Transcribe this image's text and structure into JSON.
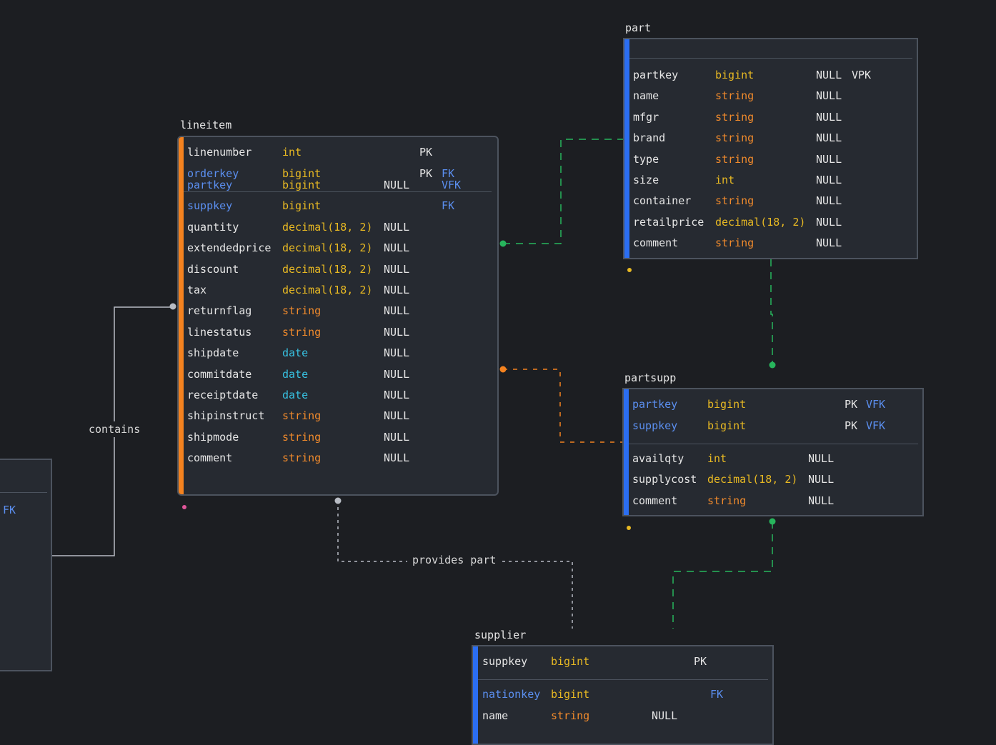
{
  "colors": {
    "background": "#1c1e22",
    "table_bg": "#262a31",
    "border": "#4c535e",
    "accent_orange": "#f4821f",
    "accent_blue": "#2b6ef2",
    "type_yellow": "#e8b923",
    "type_orange": "#f08a2c",
    "type_cyan": "#37c0e0",
    "fk_blue": "#5b8ff0",
    "edge_green": "#27b55c",
    "edge_orange": "#f4821f",
    "edge_gray": "#b8bcc4"
  },
  "edges": {
    "contains": "contains",
    "provides_part": "provides part"
  },
  "lineitem": {
    "title": "lineitem",
    "keys": [
      {
        "name": "linenumber",
        "type": "int",
        "null": "",
        "key": "PK",
        "fk": ""
      },
      {
        "name": "orderkey",
        "type": "bigint",
        "null": "",
        "key": "PK",
        "fk": "FK"
      }
    ],
    "columns": [
      {
        "name": "partkey",
        "type": "bigint",
        "null": "NULL",
        "key": "",
        "fk": "VFK"
      },
      {
        "name": "suppkey",
        "type": "bigint",
        "null": "",
        "key": "",
        "fk": "FK"
      },
      {
        "name": "quantity",
        "type": "decimal(18, 2)",
        "null": "NULL",
        "key": "",
        "fk": ""
      },
      {
        "name": "extendedprice",
        "type": "decimal(18, 2)",
        "null": "NULL",
        "key": "",
        "fk": ""
      },
      {
        "name": "discount",
        "type": "decimal(18, 2)",
        "null": "NULL",
        "key": "",
        "fk": ""
      },
      {
        "name": "tax",
        "type": "decimal(18, 2)",
        "null": "NULL",
        "key": "",
        "fk": ""
      },
      {
        "name": "returnflag",
        "type": "string",
        "null": "NULL",
        "key": "",
        "fk": ""
      },
      {
        "name": "linestatus",
        "type": "string",
        "null": "NULL",
        "key": "",
        "fk": ""
      },
      {
        "name": "shipdate",
        "type": "date",
        "null": "NULL",
        "key": "",
        "fk": ""
      },
      {
        "name": "commitdate",
        "type": "date",
        "null": "NULL",
        "key": "",
        "fk": ""
      },
      {
        "name": "receiptdate",
        "type": "date",
        "null": "NULL",
        "key": "",
        "fk": ""
      },
      {
        "name": "shipinstruct",
        "type": "string",
        "null": "NULL",
        "key": "",
        "fk": ""
      },
      {
        "name": "shipmode",
        "type": "string",
        "null": "NULL",
        "key": "",
        "fk": ""
      },
      {
        "name": "comment",
        "type": "string",
        "null": "NULL",
        "key": "",
        "fk": ""
      }
    ]
  },
  "part": {
    "title": "part",
    "columns": [
      {
        "name": "partkey",
        "type": "bigint",
        "null": "NULL",
        "key": "VPK",
        "fk": ""
      },
      {
        "name": "name",
        "type": "string",
        "null": "NULL",
        "key": "",
        "fk": ""
      },
      {
        "name": "mfgr",
        "type": "string",
        "null": "NULL",
        "key": "",
        "fk": ""
      },
      {
        "name": "brand",
        "type": "string",
        "null": "NULL",
        "key": "",
        "fk": ""
      },
      {
        "name": "type",
        "type": "string",
        "null": "NULL",
        "key": "",
        "fk": ""
      },
      {
        "name": "size",
        "type": "int",
        "null": "NULL",
        "key": "",
        "fk": ""
      },
      {
        "name": "container",
        "type": "string",
        "null": "NULL",
        "key": "",
        "fk": ""
      },
      {
        "name": "retailprice",
        "type": "decimal(18, 2)",
        "null": "NULL",
        "key": "",
        "fk": ""
      },
      {
        "name": "comment",
        "type": "string",
        "null": "NULL",
        "key": "",
        "fk": ""
      }
    ]
  },
  "partsupp": {
    "title": "partsupp",
    "keys": [
      {
        "name": "partkey",
        "type": "bigint",
        "null": "",
        "key": "PK",
        "fk": "VFK"
      },
      {
        "name": "suppkey",
        "type": "bigint",
        "null": "",
        "key": "PK",
        "fk": "VFK"
      }
    ],
    "columns": [
      {
        "name": "availqty",
        "type": "int",
        "null": "NULL",
        "key": "",
        "fk": ""
      },
      {
        "name": "supplycost",
        "type": "decimal(18, 2)",
        "null": "NULL",
        "key": "",
        "fk": ""
      },
      {
        "name": "comment",
        "type": "string",
        "null": "NULL",
        "key": "",
        "fk": ""
      }
    ]
  },
  "supplier": {
    "title": "supplier",
    "keys": [
      {
        "name": "suppkey",
        "type": "bigint",
        "null": "",
        "key": "PK",
        "fk": ""
      }
    ],
    "columns": [
      {
        "name": "nationkey",
        "type": "bigint",
        "null": "",
        "key": "",
        "fk": "FK"
      },
      {
        "name": "name",
        "type": "string",
        "null": "NULL",
        "key": "",
        "fk": ""
      }
    ]
  },
  "left_table": {
    "fk_label": "FK"
  }
}
